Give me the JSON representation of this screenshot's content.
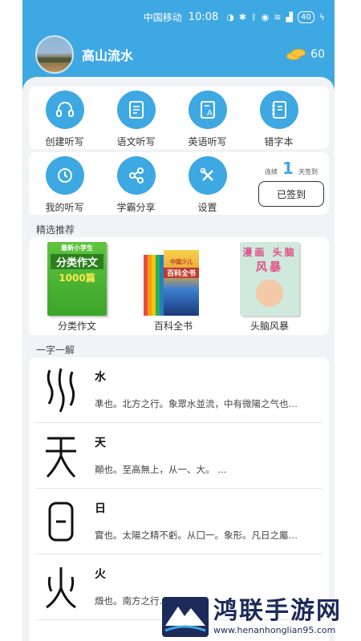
{
  "status_bar": {
    "carrier": "中国移动",
    "time": "10:08",
    "battery": "40"
  },
  "profile": {
    "username": "高山流水",
    "coins": "60"
  },
  "features_row1": [
    {
      "label": "创建听写",
      "icon": "headphones-icon"
    },
    {
      "label": "语文听写",
      "icon": "document-icon"
    },
    {
      "label": "英语听写",
      "icon": "letter-a-document-icon"
    },
    {
      "label": "错字本",
      "icon": "notebook-icon"
    }
  ],
  "features_row2": [
    {
      "label": "我的听写",
      "icon": "history-clock-icon"
    },
    {
      "label": "学霸分享",
      "icon": "share-icon"
    },
    {
      "label": "设置",
      "icon": "tools-icon"
    }
  ],
  "checkin": {
    "prefix": "连续",
    "days": "1",
    "suffix": "天签到",
    "button": "已签到"
  },
  "recommend": {
    "title": "精选推荐",
    "books": [
      {
        "label": "分类作文",
        "cover_lines": [
          "最新小学生",
          "分类作文",
          "1000篇"
        ]
      },
      {
        "label": "百科全书",
        "cover_lines": [
          "中国少儿",
          "百科全书"
        ]
      },
      {
        "label": "头脑风暴",
        "cover_lines": [
          "漫画 头脑",
          "风暴"
        ]
      }
    ]
  },
  "char_section": {
    "title": "一字一解",
    "items": [
      {
        "glyph": "氵",
        "name": "水",
        "desc": "凖也。北方之行。象眾水並流，中有微陽之气也…"
      },
      {
        "glyph": "天",
        "name": "天",
        "desc": "顚也。至高無上，从一、大。 …"
      },
      {
        "glyph": "日",
        "name": "日",
        "desc": "實也。太陽之精不虧。从囗一。象形。凡日之屬…"
      },
      {
        "glyph": "火",
        "name": "火",
        "desc": "燬也。南方之行…"
      }
    ]
  },
  "watermark": {
    "title": "鸿联手游网",
    "url": "www.henanhonglian95.com"
  },
  "colors": {
    "primary": "#3ea8e2",
    "background": "#f1f3f6"
  }
}
